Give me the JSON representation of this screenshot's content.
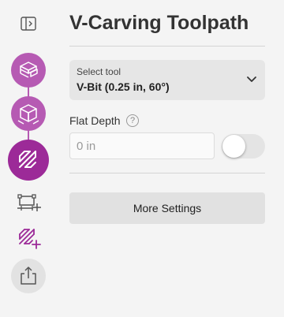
{
  "colors": {
    "accent": "#b65ab3",
    "accent_active": "#9c2a98",
    "background": "#f4f4f4"
  },
  "sidebar": {
    "collapse": {
      "icon": "sidebar-collapse-icon"
    },
    "steps": [
      {
        "id": "material",
        "icon": "layers-icon",
        "state": "complete"
      },
      {
        "id": "model",
        "icon": "cube-icon",
        "state": "complete"
      },
      {
        "id": "toolpath",
        "icon": "toolpath-icon",
        "state": "active"
      }
    ],
    "actions": [
      {
        "id": "add-stock",
        "icon": "add-stock-icon"
      },
      {
        "id": "add-toolpath",
        "icon": "add-toolpath-icon"
      },
      {
        "id": "export",
        "icon": "export-icon"
      }
    ]
  },
  "panel": {
    "title": "V-Carving Toolpath",
    "tool_select": {
      "label": "Select tool",
      "value": "V-Bit (0.25 in, 60°)"
    },
    "flat_depth": {
      "label": "Flat Depth",
      "help_glyph": "?",
      "value": "",
      "placeholder": "0 in",
      "toggle_on": false
    },
    "more_settings_label": "More Settings"
  }
}
